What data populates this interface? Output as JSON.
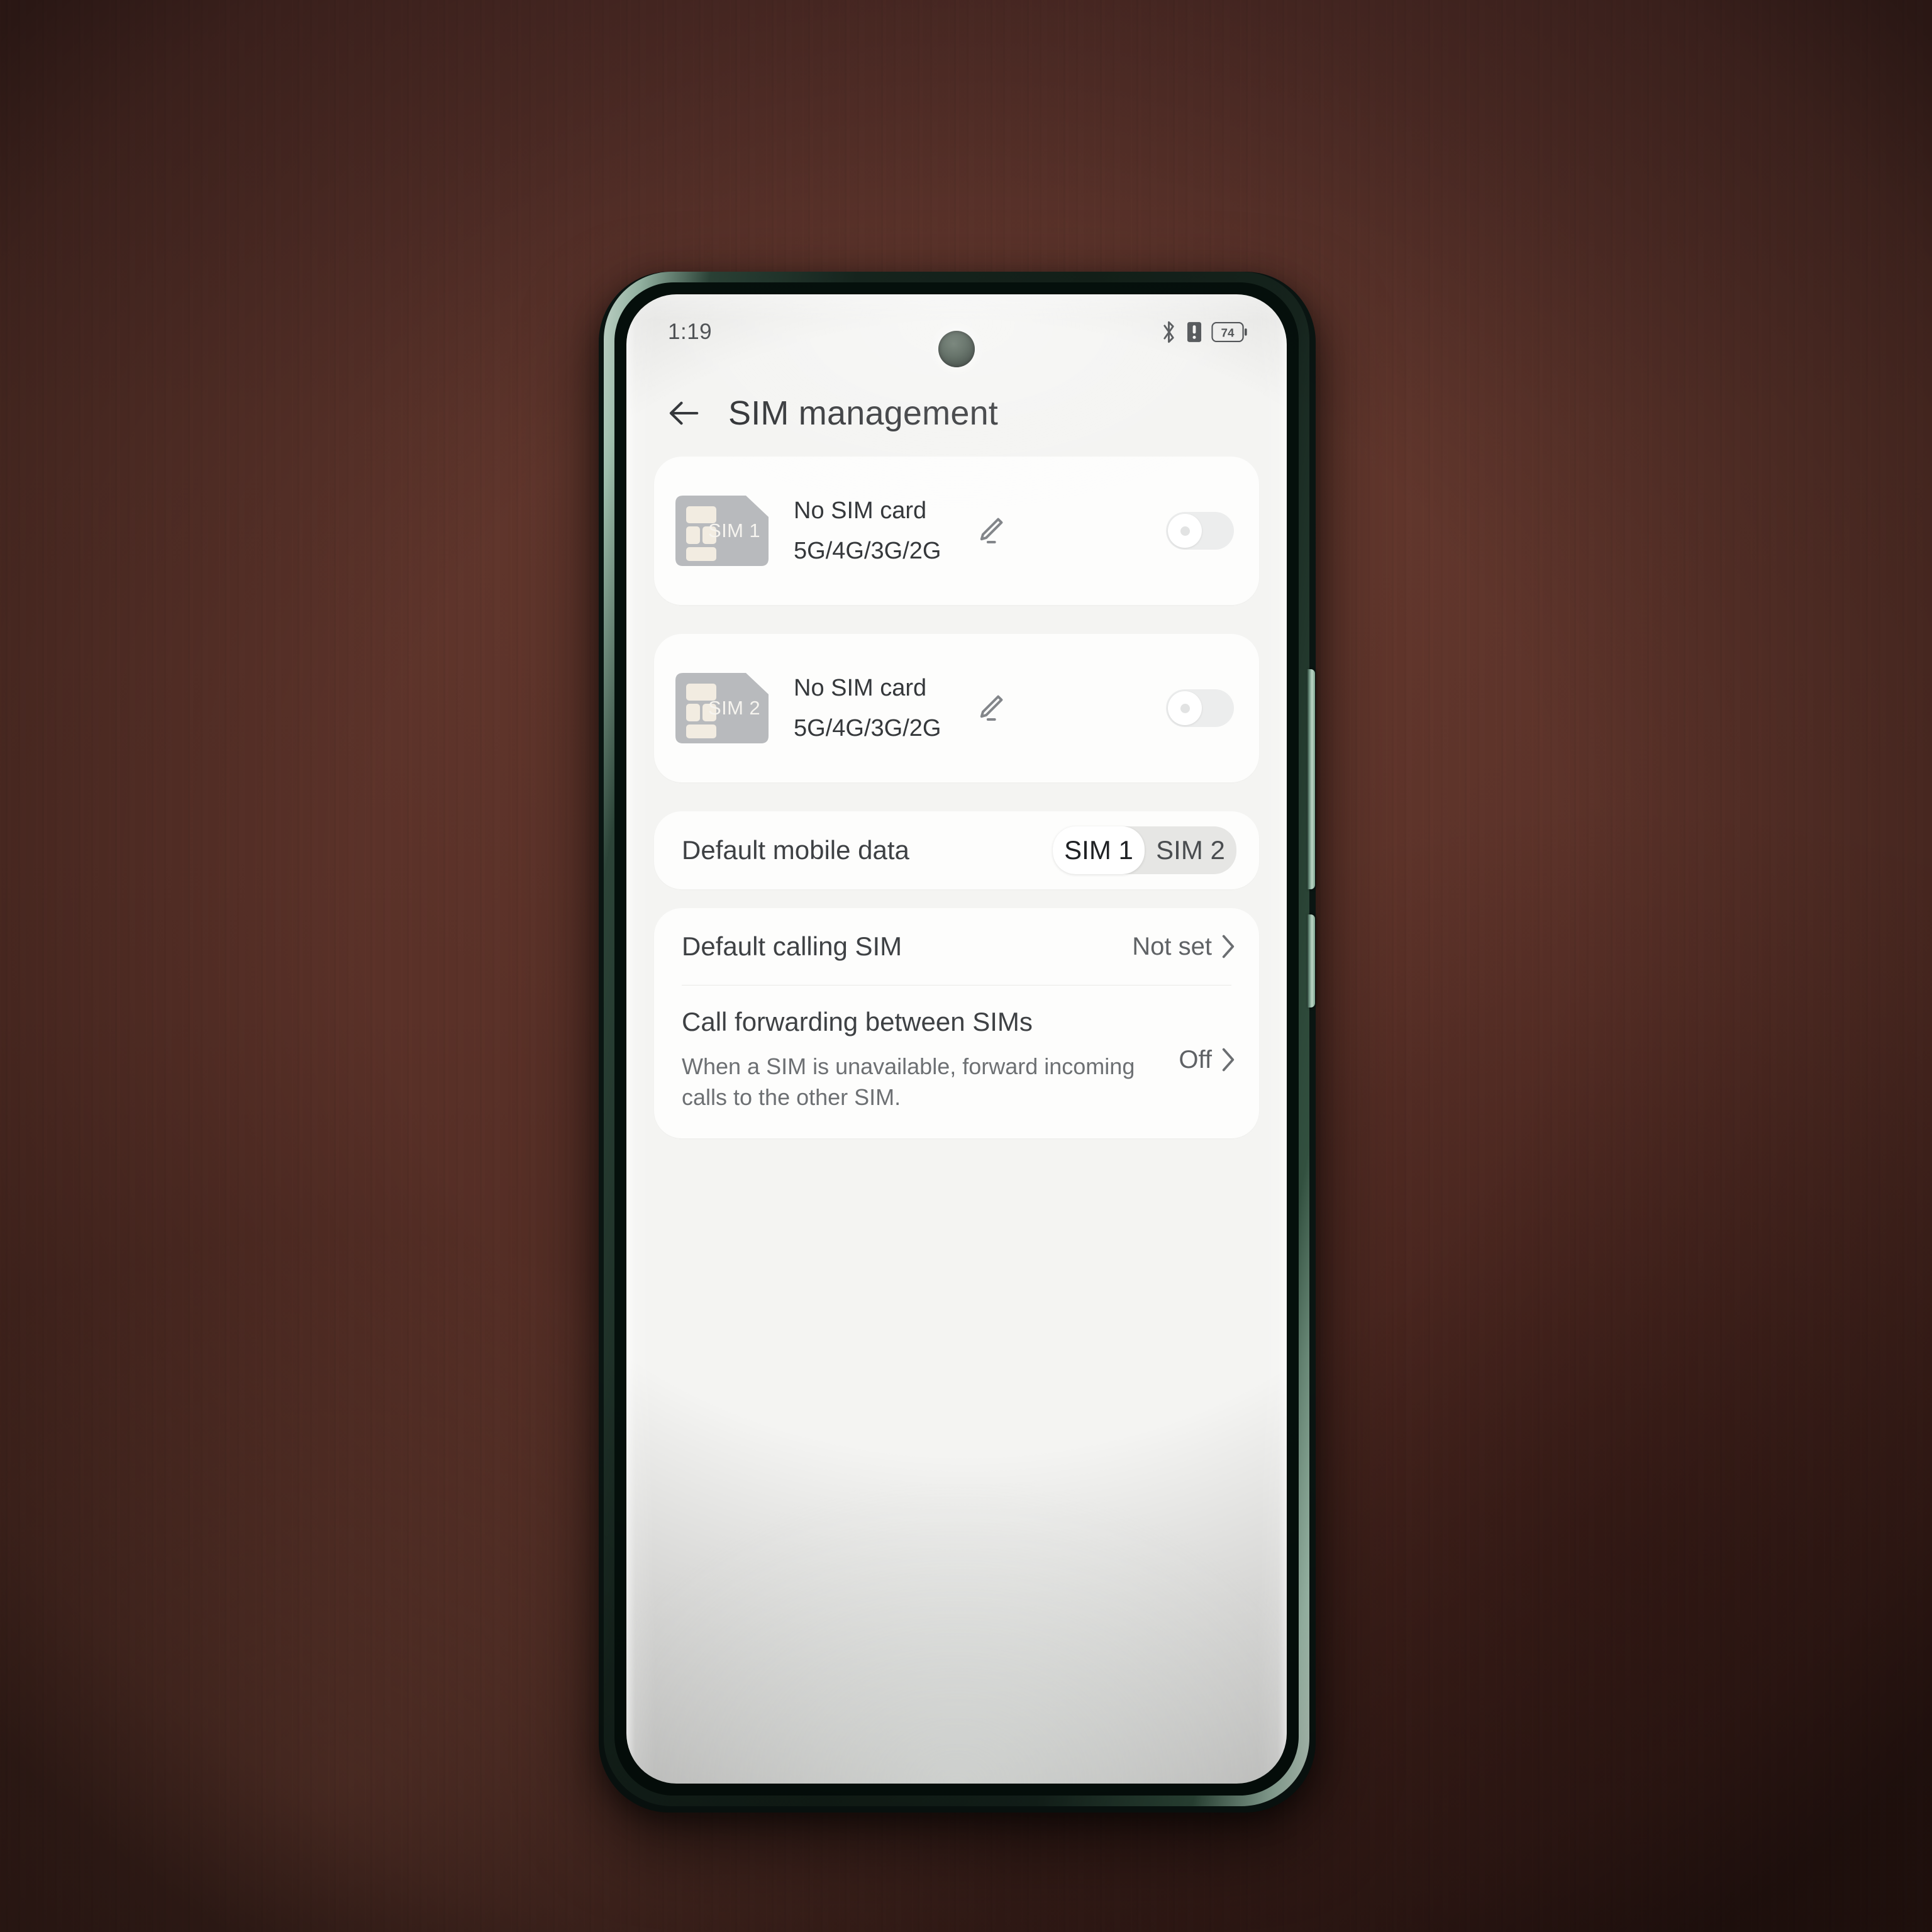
{
  "status_bar": {
    "time": "1:19",
    "icons": [
      "bluetooth-icon",
      "sim-signal-icon",
      "battery-icon"
    ],
    "battery_level": "74"
  },
  "header": {
    "back_icon": "arrow-left-icon",
    "title": "SIM management"
  },
  "sim_cards": [
    {
      "chip_label": "SIM 1",
      "title": "No SIM card",
      "subtitle": "5G/4G/3G/2G",
      "edit_icon": "pencil-icon",
      "toggle_state": "off"
    },
    {
      "chip_label": "SIM 2",
      "title": "No SIM card",
      "subtitle": "5G/4G/3G/2G",
      "edit_icon": "pencil-icon",
      "toggle_state": "off"
    }
  ],
  "default_mobile_data": {
    "label": "Default mobile data",
    "options": [
      "SIM 1",
      "SIM 2"
    ],
    "selected": "SIM 1"
  },
  "settings_rows": [
    {
      "title": "Default calling SIM",
      "description": "",
      "value": "Not set",
      "chevron_icon": "chevron-right-icon"
    },
    {
      "title": "Call forwarding between SIMs",
      "description": "When a SIM is unavailable, forward incoming calls to the other SIM.",
      "value": "Off",
      "chevron_icon": "chevron-right-icon"
    }
  ],
  "colors": {
    "screen_bg": "#f4f4f2",
    "card_bg": "#fdfdfc",
    "text_primary": "#35383b",
    "text_secondary": "#6d7073",
    "phone_frame": "#16251e",
    "desk": "#5a3228"
  }
}
